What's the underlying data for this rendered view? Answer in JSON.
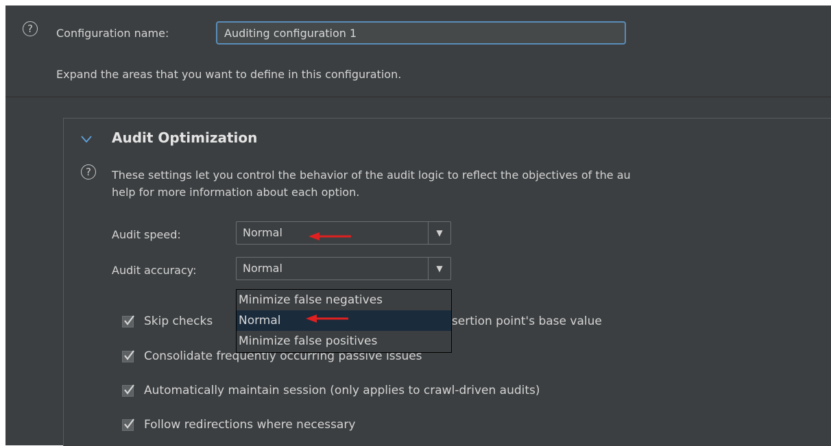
{
  "config": {
    "name_label": "Configuration name:",
    "name_value": "Auditing configuration 1",
    "instructions": "Expand the areas that you want to define in this configuration."
  },
  "section": {
    "title": "Audit Optimization",
    "description": "These settings let you control the behavior of the audit logic to reflect the objectives of the au\nhelp for more information about each option."
  },
  "fields": {
    "audit_speed": {
      "label": "Audit speed:",
      "value": "Normal"
    },
    "audit_accuracy": {
      "label": "Audit accuracy:",
      "value": "Normal",
      "options": [
        "Minimize false negatives",
        "Normal",
        "Minimize false positives"
      ],
      "highlighted_index": 1
    }
  },
  "checkboxes": [
    {
      "label": "Skip checks ",
      "label_tail": "o insertion point's base value",
      "checked": true
    },
    {
      "label": "Consolidate frequently occurring passive issues",
      "checked": true
    },
    {
      "label": "Automatically maintain session (only applies to crawl-driven audits)",
      "checked": true
    },
    {
      "label": "Follow redirections where necessary",
      "checked": true
    }
  ],
  "icons": {
    "help": "?",
    "chevron": "chevron-down-icon",
    "combo_arrow": "▼"
  },
  "colors": {
    "background": "#3c3f41",
    "input_focus_border": "#5a8dba",
    "selection": "#1a2b3c",
    "annotation_arrow": "#e02020"
  }
}
